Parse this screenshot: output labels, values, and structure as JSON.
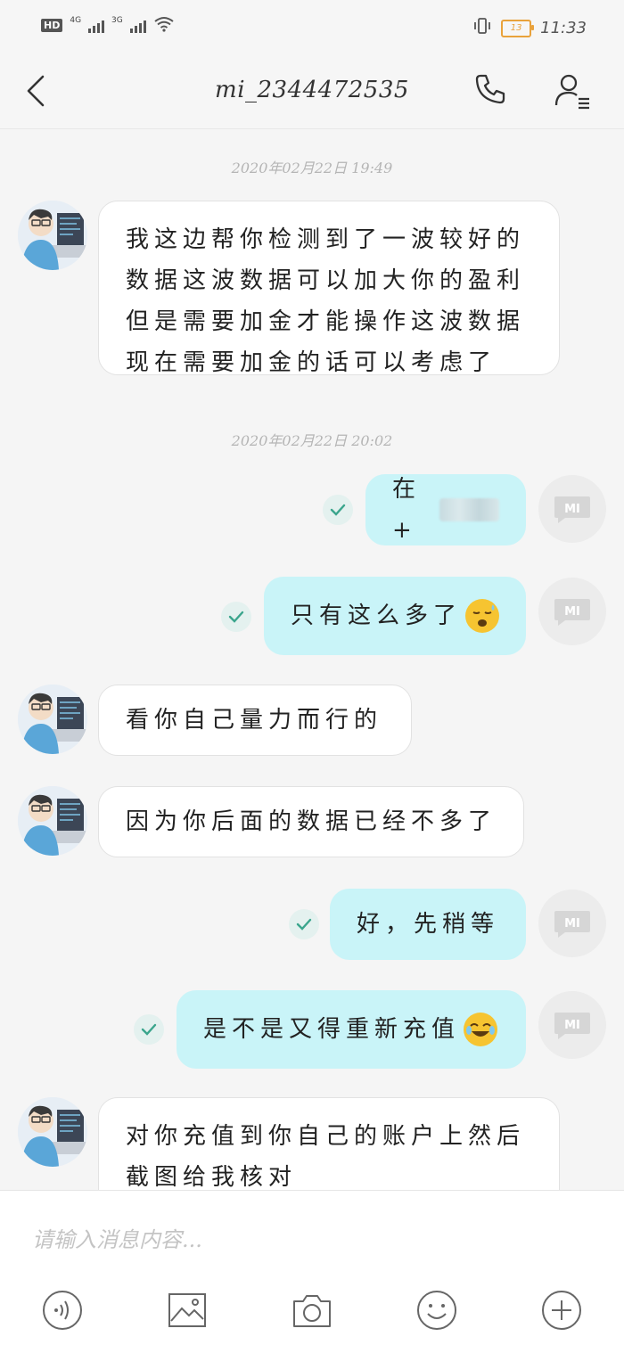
{
  "status_bar": {
    "hd": "HD",
    "signal1": "4G",
    "signal2": "3G",
    "battery": "13",
    "time": "11:33"
  },
  "header": {
    "title": "mi_2344472535"
  },
  "chat": {
    "timestamp1": "2020年02月22日 19:49",
    "msg1_line1": "我这边帮你检测到了一波较好的",
    "msg1_line2": "数据这波数据可以加大你的盈利",
    "msg1_line3": "但是需要加金才能操作这波数据",
    "msg1_line4": "现在需要加金的话可以考虑了",
    "timestamp2": "2020年02月22日 20:02",
    "msg2": "在+",
    "msg3": "只有这么多了",
    "msg4": "看你自己量力而行的",
    "msg5": "因为你后面的数据已经不多了",
    "msg6": "好，先稍等",
    "msg7": "是不是又得重新充值",
    "msg8_line1": "对你充值到你自己的账户上然后",
    "msg8_line2": "截图给我核对"
  },
  "input": {
    "placeholder": "请输入消息内容..."
  },
  "icons": {
    "back": "back-arrow-icon",
    "call": "phone-icon",
    "profile": "profile-icon",
    "voice": "voice-icon",
    "image": "image-icon",
    "camera": "camera-icon",
    "emoji": "emoji-icon",
    "plus": "plus-icon"
  },
  "colors": {
    "outgoing_bubble": "#c9f4f8",
    "incoming_bubble": "#ffffff",
    "background": "#f5f5f5"
  }
}
